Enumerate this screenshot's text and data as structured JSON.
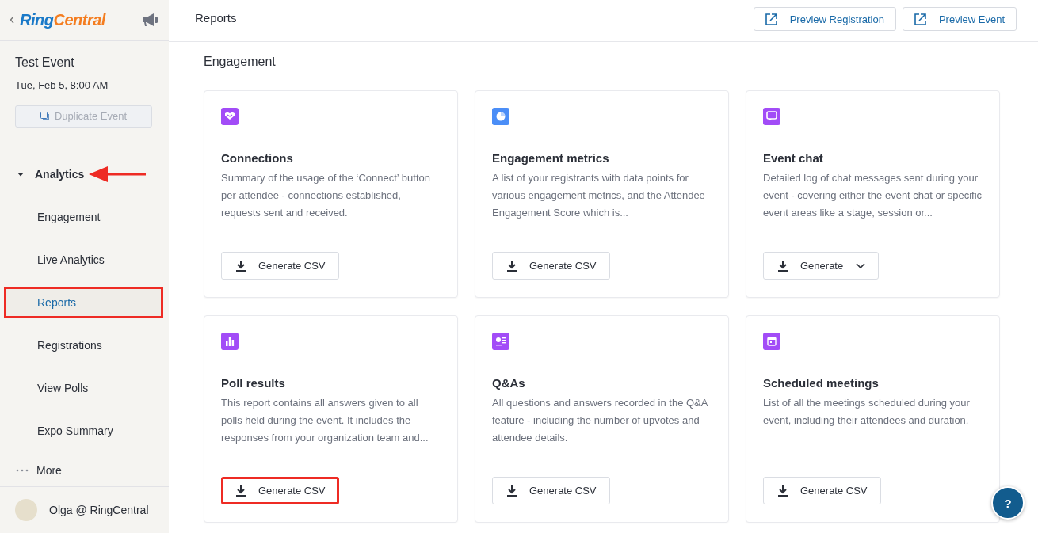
{
  "sidebar": {
    "logo_parts": [
      "Ring",
      "Central"
    ],
    "event": {
      "title": "Test Event",
      "date": "Tue, Feb 5, 8:00 AM",
      "duplicate_button": {
        "label": "Duplicate Event",
        "disabled": true
      }
    },
    "section": {
      "label": "Analytics",
      "expanded": true,
      "annotated": true
    },
    "items": [
      {
        "label": "Engagement",
        "selected": false,
        "highlighted": false
      },
      {
        "label": "Live Analytics",
        "selected": false,
        "highlighted": false
      },
      {
        "label": "Reports",
        "selected": true,
        "highlighted": true
      },
      {
        "label": "Registrations",
        "selected": false,
        "highlighted": false
      },
      {
        "label": "View Polls",
        "selected": false,
        "highlighted": false
      },
      {
        "label": "Expo Summary",
        "selected": false,
        "highlighted": false
      }
    ],
    "more": "More",
    "user": "Olga @ RingCentral"
  },
  "header": {
    "title": "Reports",
    "buttons": [
      "Preview Registration",
      "Preview Event"
    ]
  },
  "section_title": "Engagement",
  "cards": [
    {
      "color": "#a24cf7",
      "title": "Connections",
      "description": "Summary of the usage of the ‘Connect’ button per attendee - connections established, requests sent and received.",
      "button": {
        "label": "Generate CSV",
        "kind": "plain",
        "highlighted": false
      }
    },
    {
      "color": "#4b8ef7",
      "title": "Engagement metrics",
      "description": "A list of your registrants with data points for various engagement metrics, and the Attendee Engagement Score which is...",
      "button": {
        "label": "Generate CSV",
        "kind": "plain",
        "highlighted": false
      }
    },
    {
      "color": "#a24cf7",
      "title": "Event chat",
      "description": "Detailed log of chat messages sent during your event - covering either the event chat or specific event areas like a stage, session or...",
      "button": {
        "label": "Generate",
        "kind": "dropdown",
        "highlighted": false
      }
    },
    {
      "color": "#a24cf7",
      "title": "Poll results",
      "description": "This report contains all answers given to all polls held during the event. It includes the responses from your organization team and...",
      "button": {
        "label": "Generate CSV",
        "kind": "plain",
        "highlighted": true
      }
    },
    {
      "color": "#a24cf7",
      "title": "Q&As",
      "description": "All questions and answers recorded in the Q&A feature - including the number of upvotes and attendee details.",
      "button": {
        "label": "Generate CSV",
        "kind": "plain",
        "highlighted": false
      }
    },
    {
      "color": "#a24cf7",
      "title": "Scheduled meetings",
      "description": "List of all the meetings scheduled during your event, including their attendees and duration.",
      "button": {
        "label": "Generate CSV",
        "kind": "plain",
        "highlighted": false
      }
    }
  ],
  "help_button": "?"
}
